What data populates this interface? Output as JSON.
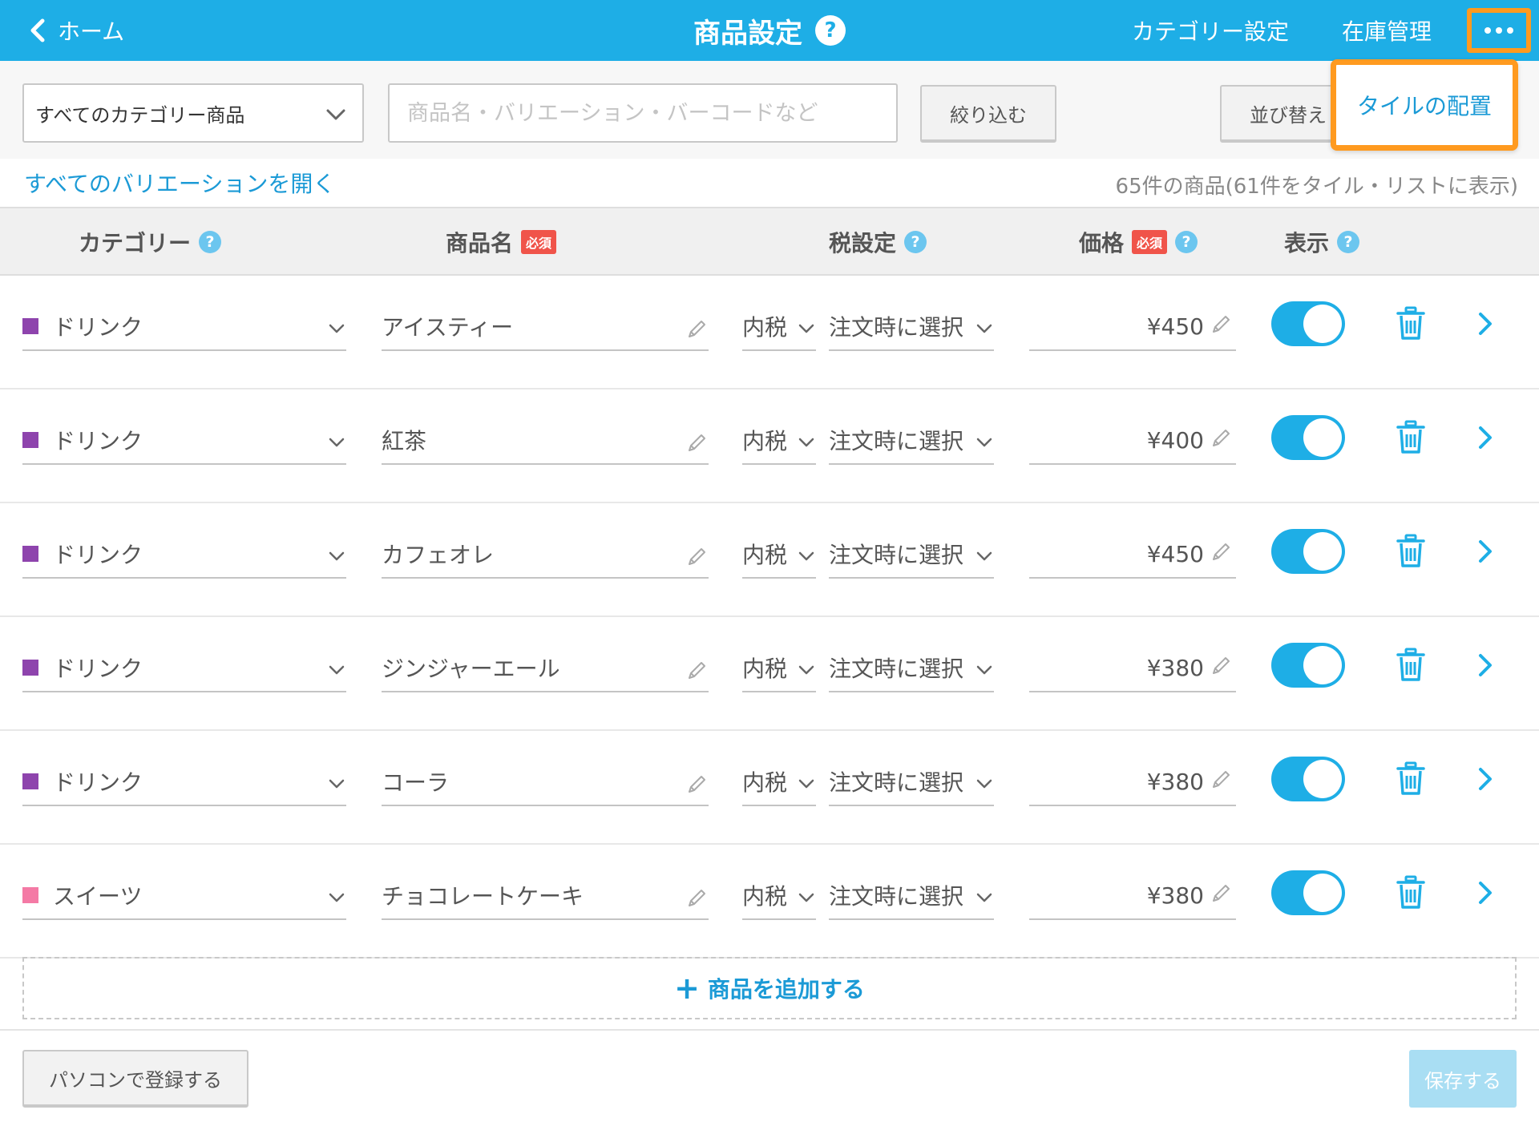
{
  "header": {
    "back_label": "ホーム",
    "title": "商品設定",
    "help": "?",
    "category_settings": "カテゴリー設定",
    "inventory": "在庫管理"
  },
  "toolbar": {
    "category_select_value": "すべてのカテゴリー商品",
    "search_placeholder": "商品名・バリエーション・バーコードなど",
    "filter_label": "絞り込む",
    "sort_label": "並び替え"
  },
  "menu": {
    "tile_layout": "タイルの配置"
  },
  "info": {
    "expand_variations": "すべてのバリエーションを開く",
    "count_text": "65件の商品(61件をタイル・リストに表示)"
  },
  "columns": {
    "category": "カテゴリー",
    "product_name": "商品名",
    "required": "必須",
    "tax": "税設定",
    "price": "価格",
    "display": "表示"
  },
  "colors": {
    "accent": "#1eaee6",
    "highlight": "#ff9a1f",
    "drink": "#8e44ad",
    "sweets": "#f47aa5"
  },
  "products": [
    {
      "category": "ドリンク",
      "category_color": "#8e44ad",
      "name": "アイスティー",
      "tax_type": "内税",
      "tax_rate": "注文時に選択",
      "price": "¥450",
      "visible": true
    },
    {
      "category": "ドリンク",
      "category_color": "#8e44ad",
      "name": "紅茶",
      "tax_type": "内税",
      "tax_rate": "注文時に選択",
      "price": "¥400",
      "visible": true
    },
    {
      "category": "ドリンク",
      "category_color": "#8e44ad",
      "name": "カフェオレ",
      "tax_type": "内税",
      "tax_rate": "注文時に選択",
      "price": "¥450",
      "visible": true
    },
    {
      "category": "ドリンク",
      "category_color": "#8e44ad",
      "name": "ジンジャーエール",
      "tax_type": "内税",
      "tax_rate": "注文時に選択",
      "price": "¥380",
      "visible": true
    },
    {
      "category": "ドリンク",
      "category_color": "#8e44ad",
      "name": "コーラ",
      "tax_type": "内税",
      "tax_rate": "注文時に選択",
      "price": "¥380",
      "visible": true
    },
    {
      "category": "スイーツ",
      "category_color": "#f47aa5",
      "name": "チョコレートケーキ",
      "tax_type": "内税",
      "tax_rate": "注文時に選択",
      "price": "¥380",
      "visible": true
    }
  ],
  "actions": {
    "add_product": "商品を追加する",
    "add_plus": "+",
    "register_pc": "パソコンで登録する",
    "save": "保存する"
  }
}
